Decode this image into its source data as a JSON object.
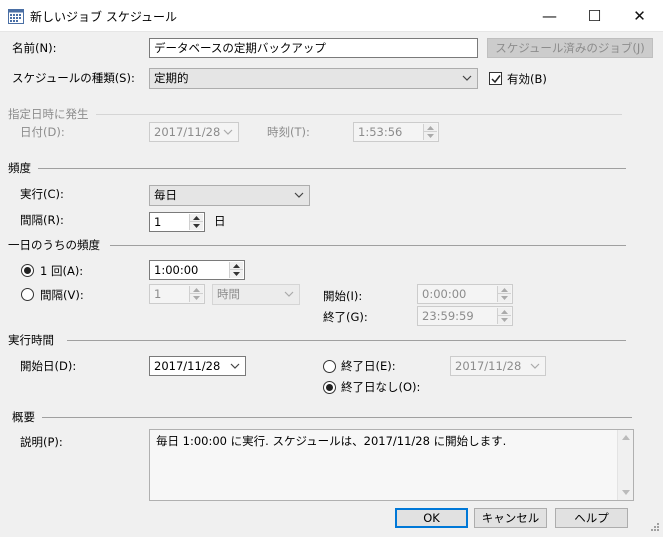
{
  "window": {
    "title": "新しいジョブ スケジュール",
    "minimize": "—",
    "maximize": "☐",
    "close": "✕"
  },
  "name": {
    "label": "名前(N):",
    "value": "データベースの定期バックアップ",
    "scheduled_jobs_button": "スケジュール済みのジョブ(J)"
  },
  "schedule_type": {
    "label": "スケジュールの種類(S):",
    "value": "定期的",
    "enabled_label": "有効(B)",
    "enabled": true
  },
  "one_time": {
    "header": "指定日時に発生",
    "date_label": "日付(D):",
    "date_value": "2017/11/28",
    "time_label": "時刻(T):",
    "time_value": "1:53:56"
  },
  "frequency": {
    "header": "頻度",
    "occurs_label": "実行(C):",
    "occurs_value": "毎日",
    "recurs_label": "間隔(R):",
    "recurs_value": "1",
    "recurs_unit": "日"
  },
  "daily_frequency": {
    "header": "一日のうちの頻度",
    "once_label": "1 回(A):",
    "once_value": "1:00:00",
    "once_selected": true,
    "every_label": "間隔(V):",
    "every_value": "1",
    "every_unit": "時間",
    "start_label": "開始(I):",
    "start_value": "0:00:00",
    "end_label": "終了(G):",
    "end_value": "23:59:59"
  },
  "duration": {
    "header": "実行時間",
    "start_date_label": "開始日(D):",
    "start_date_value": "2017/11/28",
    "end_date_label": "終了日(E):",
    "end_date_value": "2017/11/28",
    "no_end_date_label": "終了日なし(O):",
    "no_end_selected": true
  },
  "summary": {
    "header": "概要",
    "description_label": "説明(P):",
    "description_text": "毎日  1:00:00 に実行. スケジュールは、2017/11/28 に開始します."
  },
  "footer": {
    "ok": "OK",
    "cancel": "キャンセル",
    "help": "ヘルプ"
  }
}
